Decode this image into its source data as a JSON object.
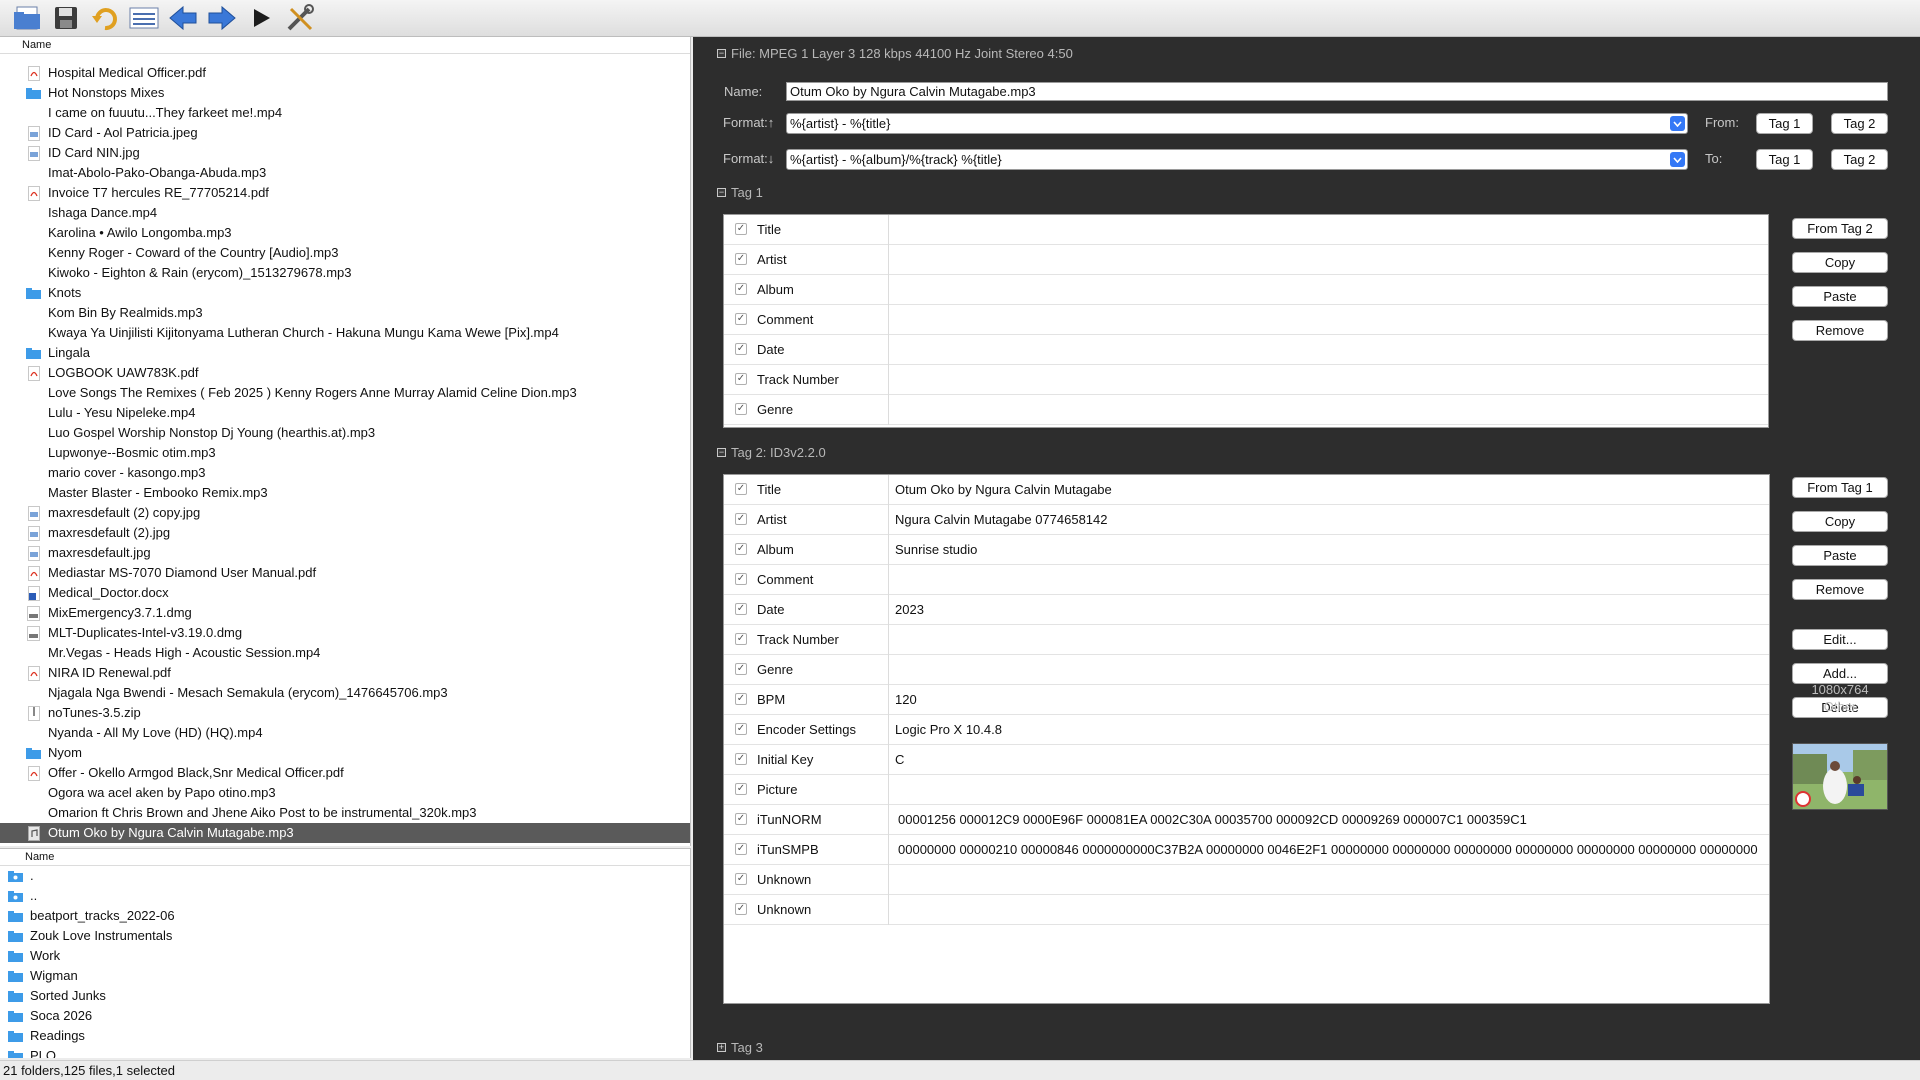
{
  "toolbar": {
    "buttons": [
      {
        "name": "open-folder-icon"
      },
      {
        "name": "save-icon"
      },
      {
        "name": "undo-icon"
      },
      {
        "name": "format-list-icon"
      },
      {
        "name": "previous-arrow-icon"
      },
      {
        "name": "next-arrow-icon"
      },
      {
        "name": "play-icon"
      },
      {
        "name": "tools-icon"
      }
    ]
  },
  "file_list": {
    "header": "Name",
    "rows": [
      {
        "name": "Hospital Medical Officer.pdf",
        "type": "pdf"
      },
      {
        "name": "Hot Nonstops Mixes",
        "type": "folder"
      },
      {
        "name": "I came on fuuutu...They farkeet me!.mp4",
        "type": "none"
      },
      {
        "name": "ID Card - Aol Patricia.jpeg",
        "type": "image"
      },
      {
        "name": "ID Card NIN.jpg",
        "type": "image"
      },
      {
        "name": "Imat-Abolo-Pako-Obanga-Abuda.mp3",
        "type": "none"
      },
      {
        "name": "Invoice T7 hercules RE_77705214.pdf",
        "type": "pdf"
      },
      {
        "name": "Ishaga Dance.mp4",
        "type": "none"
      },
      {
        "name": "Karolina • Awilo Longomba.mp3",
        "type": "none"
      },
      {
        "name": "Kenny Roger - Coward of the Country [Audio].mp3",
        "type": "none"
      },
      {
        "name": "Kiwoko - Eighton & Rain (erycom)_1513279678.mp3",
        "type": "none"
      },
      {
        "name": "Knots",
        "type": "folder"
      },
      {
        "name": "Kom Bin By Realmids.mp3",
        "type": "none"
      },
      {
        "name": "Kwaya Ya Uinjilisti Kijitonyama Lutheran Church - Hakuna Mungu Kama Wewe [Pix].mp4",
        "type": "none"
      },
      {
        "name": "Lingala",
        "type": "folder"
      },
      {
        "name": "LOGBOOK UAW783K.pdf",
        "type": "pdf"
      },
      {
        "name": "Love Songs The Remixes ( Feb 2025 ) Kenny Rogers  Anne Murray  Alamid  Celine Dion.mp3",
        "type": "none"
      },
      {
        "name": "Lulu - Yesu Nipeleke.mp4",
        "type": "none"
      },
      {
        "name": "Luo Gospel Worship Nonstop  Dj Young (hearthis.at).mp3",
        "type": "none"
      },
      {
        "name": "Lupwonye--Bosmic otim.mp3",
        "type": "none"
      },
      {
        "name": "mario cover - kasongo.mp3",
        "type": "none"
      },
      {
        "name": "Master Blaster - Embooko Remix.mp3",
        "type": "none"
      },
      {
        "name": "maxresdefault (2) copy.jpg",
        "type": "image"
      },
      {
        "name": "maxresdefault (2).jpg",
        "type": "image"
      },
      {
        "name": "maxresdefault.jpg",
        "type": "image"
      },
      {
        "name": "Mediastar MS-7070 Diamond User Manual.pdf",
        "type": "pdf"
      },
      {
        "name": "Medical_Doctor.docx",
        "type": "doc"
      },
      {
        "name": "MixEmergency3.7.1.dmg",
        "type": "dmg"
      },
      {
        "name": "MLT-Duplicates-Intel-v3.19.0.dmg",
        "type": "dmg"
      },
      {
        "name": "Mr.Vegas - Heads High -  Acoustic Session.mp4",
        "type": "none"
      },
      {
        "name": "NIRA ID Renewal.pdf",
        "type": "pdf"
      },
      {
        "name": "Njagala Nga Bwendi - Mesach Semakula (erycom)_1476645706.mp3",
        "type": "none"
      },
      {
        "name": "noTunes-3.5.zip",
        "type": "zip"
      },
      {
        "name": "Nyanda - All My Love (HD) (HQ).mp4",
        "type": "none"
      },
      {
        "name": "Nyom",
        "type": "folder"
      },
      {
        "name": "Offer - Okello Armgod Black,Snr Medical Officer.pdf",
        "type": "pdf"
      },
      {
        "name": "Ogora wa acel aken by Papo otino.mp3",
        "type": "none"
      },
      {
        "name": "Omarion ft Chris Brown and Jhene Aiko Post to be instrumental_320k.mp3",
        "type": "none"
      },
      {
        "name": "Otum Oko by  Ngura Calvin Mutagabe.mp3",
        "type": "audio",
        "selected": true
      }
    ]
  },
  "folder_list": {
    "header": "Name",
    "rows": [
      {
        "name": ".",
        "type": "folder-special"
      },
      {
        "name": "..",
        "type": "folder-special"
      },
      {
        "name": "beatport_tracks_2022-06",
        "type": "folder"
      },
      {
        "name": "Zouk Love Instrumentals",
        "type": "folder"
      },
      {
        "name": "Work",
        "type": "folder"
      },
      {
        "name": "Wigman",
        "type": "folder"
      },
      {
        "name": "Sorted Junks",
        "type": "folder"
      },
      {
        "name": "Soca 2026",
        "type": "folder"
      },
      {
        "name": "Readings",
        "type": "folder"
      },
      {
        "name": "PLO",
        "type": "folder"
      }
    ]
  },
  "status_bar": {
    "text": "21 folders,125 files,1 selected"
  },
  "file_section": {
    "title": "File: MPEG 1 Layer 3 128 kbps 44100 Hz Joint Stereo 4:50"
  },
  "name_field": {
    "label": "Name:",
    "value": "Otum Oko by  Ngura Calvin Mutagabe.mp3"
  },
  "format_from": {
    "label": "Format:↑",
    "value": "%{artist} - %{title}",
    "side_label": "From:",
    "tag1": "Tag 1",
    "tag2": "Tag 2"
  },
  "format_to": {
    "label": "Format:↓",
    "value": "%{artist} - %{album}/%{track} %{title}",
    "side_label": "To:",
    "tag1": "Tag 1",
    "tag2": "Tag 2"
  },
  "tag1": {
    "title": "Tag 1",
    "rows": [
      {
        "name": "Title",
        "value": ""
      },
      {
        "name": "Artist",
        "value": ""
      },
      {
        "name": "Album",
        "value": ""
      },
      {
        "name": "Comment",
        "value": ""
      },
      {
        "name": "Date",
        "value": ""
      },
      {
        "name": "Track Number",
        "value": ""
      },
      {
        "name": "Genre",
        "value": ""
      }
    ],
    "buttons": [
      "From Tag 2",
      "Copy",
      "Paste",
      "Remove"
    ]
  },
  "tag2": {
    "title": "Tag 2: ID3v2.2.0",
    "rows": [
      {
        "name": "Title",
        "value": "Otum Oko by  Ngura Calvin Mutagabe"
      },
      {
        "name": "Artist",
        "value": "Ngura Calvin Mutagabe 0774658142"
      },
      {
        "name": "Album",
        "value": "Sunrise studio"
      },
      {
        "name": "Comment",
        "value": ""
      },
      {
        "name": "Date",
        "value": "2023"
      },
      {
        "name": "Track Number",
        "value": ""
      },
      {
        "name": "Genre",
        "value": ""
      },
      {
        "name": "BPM",
        "value": "120"
      },
      {
        "name": "Encoder Settings",
        "value": "Logic Pro X 10.4.8"
      },
      {
        "name": "Initial Key",
        "value": "C"
      },
      {
        "name": "Picture",
        "value": ""
      },
      {
        "name": "iTunNORM",
        "value": " 00001256 000012C9 0000E96F 000081EA 0002C30A 00035700 000092CD 00009269 000007C1 000359C1"
      },
      {
        "name": "iTunSMPB",
        "value": " 00000000 00000210 00000846 0000000000C37B2A 00000000 0046E2F1 00000000 00000000 00000000 00000000 00000000 00000000 00000000"
      },
      {
        "name": "Unknown",
        "value": ""
      },
      {
        "name": "Unknown",
        "value": ""
      }
    ],
    "buttons": [
      "From Tag 1",
      "Copy",
      "Paste",
      "Remove",
      "Edit...",
      "Add...",
      "Delete"
    ],
    "picture": {
      "size": "1080x764",
      "type": "Other"
    }
  },
  "tag3": {
    "title": "Tag 3"
  }
}
